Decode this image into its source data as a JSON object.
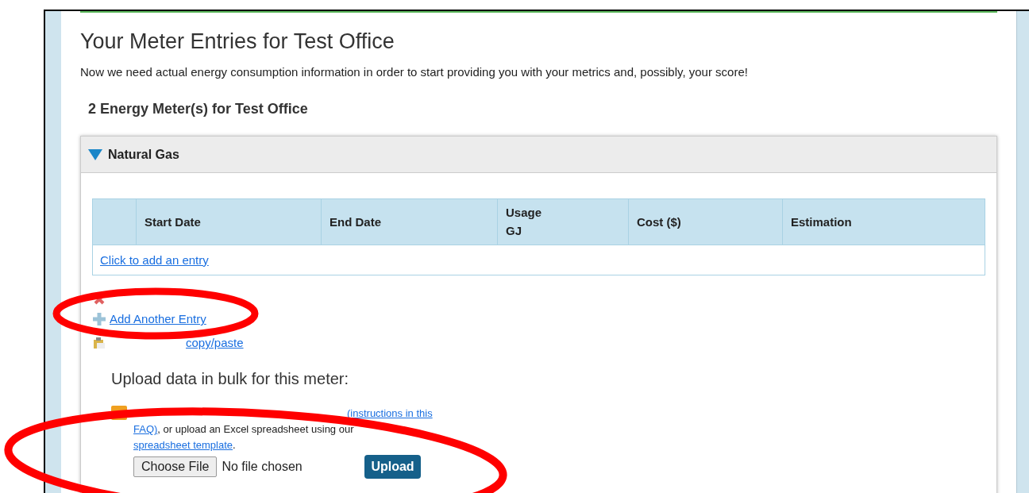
{
  "title": "Your Meter Entries for Test Office",
  "intro": "Now we need actual energy consumption information in order to start providing you with your metrics and, possibly, your score!",
  "meters_heading": "2 Energy Meter(s) for Test Office",
  "meter": {
    "name": "Natural Gas",
    "expanded": true,
    "table": {
      "columns": [
        {
          "label": "Start Date"
        },
        {
          "label": "End Date"
        },
        {
          "label": "Usage",
          "sub": "GJ"
        },
        {
          "label": "Cost ($)"
        },
        {
          "label": "Estimation"
        }
      ],
      "add_link": "Click to add an entry"
    },
    "actions": [
      {
        "kind": "delete"
      },
      {
        "kind": "add",
        "label": "Add Another Entry"
      },
      {
        "kind": "paste",
        "label": "copy/paste"
      }
    ],
    "upload": {
      "heading": "Upload data in bulk for this meter:",
      "link1_start": "(instructions in this",
      "link1_end": "FAQ)",
      "text_mid": ", or upload an Excel spreadsheet using our",
      "link2": "spreadsheet template",
      "text_end": ".",
      "choose_button": "Choose File",
      "file_status": "No file chosen",
      "upload_button": "Upload"
    }
  }
}
